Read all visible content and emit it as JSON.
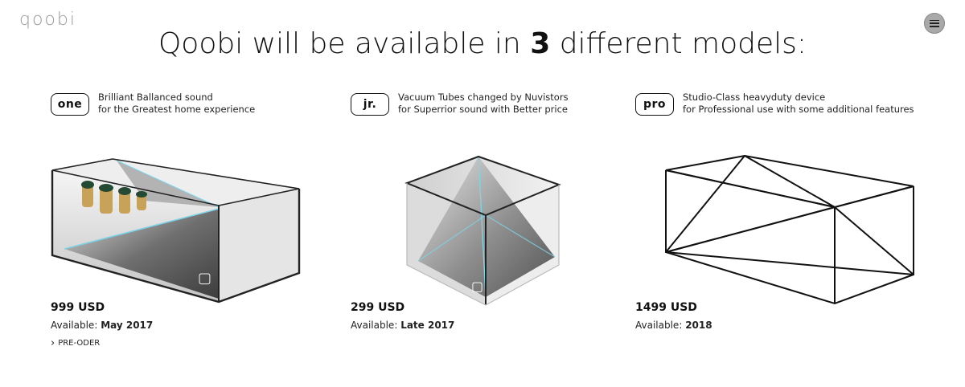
{
  "brand": {
    "logo_text": "qoobi"
  },
  "header": {
    "title_before": "Qoobi will be available in",
    "title_number": "3",
    "title_after": "different models:"
  },
  "models": [
    {
      "badge": "one",
      "desc_line1": "Brilliant Ballanced sound",
      "desc_line2": "for the Greatest home experience",
      "price": "999 USD",
      "available_label": "Available:",
      "available_value": "May 2017",
      "cta": "PRE-ODER"
    },
    {
      "badge": "jr.",
      "desc_line1": "Vacuum Tubes changed by Nuvistors",
      "desc_line2": "for Superrior sound with Better price",
      "price": "299 USD",
      "available_label": "Available:",
      "available_value": "Late 2017"
    },
    {
      "badge": "pro",
      "desc_line1": "Studio-Class heavyduty device",
      "desc_line2": "for Professional use with some additional features",
      "price": "1499 USD",
      "available_label": "Available:",
      "available_value": "2018"
    }
  ],
  "icons": {
    "menu": "hamburger-icon",
    "cta": "chevron-right-icon"
  },
  "colors": {
    "accent_glow": "#7fd3e6",
    "menu_bg": "#a9a9a9",
    "logo": "#9a9a9a"
  }
}
